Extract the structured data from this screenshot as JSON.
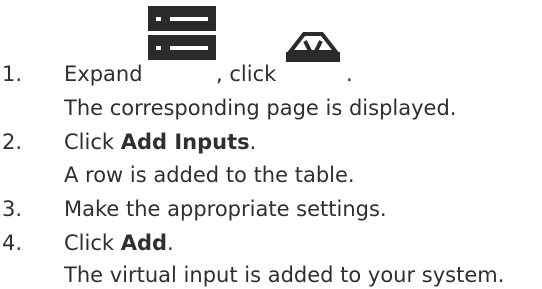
{
  "steps": [
    {
      "number": "1.",
      "text_before": "Expand",
      "text_middle": ", click",
      "text_after": ".",
      "result": "The corresponding page is displayed."
    },
    {
      "number": "2.",
      "text_before": "Click ",
      "bold": "Add Inputs",
      "text_after": ".",
      "result": "A row is added to the table."
    },
    {
      "number": "3.",
      "text": "Make the appropriate settings."
    },
    {
      "number": "4.",
      "text_before": "Click ",
      "bold": "Add",
      "text_after": ".",
      "result": "The virtual input is added to your system."
    }
  ],
  "icons": {
    "expand": "list-expand-icon",
    "virtual_input": "virtual-input-icon"
  }
}
